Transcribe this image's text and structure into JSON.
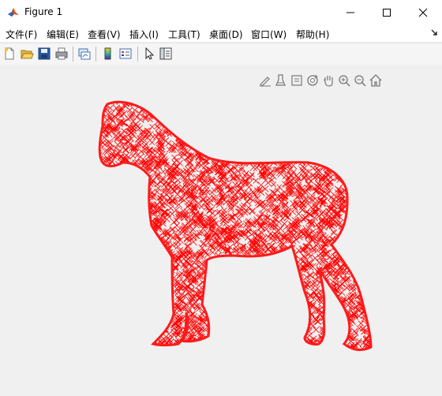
{
  "window": {
    "title": "Figure 1"
  },
  "menu": [
    "文件(F)",
    "编辑(E)",
    "查看(V)",
    "插入(I)",
    "工具(T)",
    "桌面(D)",
    "窗口(W)",
    "帮助(H)"
  ],
  "toolbar": [
    "new-figure-icon",
    "open-file-icon",
    "save-icon",
    "print-icon",
    "link-plot-icon",
    "insert-colorbar-icon",
    "insert-legend-icon",
    "pointer-icon",
    "property-inspector-icon"
  ],
  "axes_toolbar": [
    "edit-plot-icon",
    "brush-icon",
    "data-tips-icon",
    "rotate-3d-icon",
    "pan-icon",
    "zoom-in-icon",
    "zoom-out-icon",
    "home-icon"
  ],
  "plot": {
    "marker": "x",
    "color": "#ff0000"
  }
}
